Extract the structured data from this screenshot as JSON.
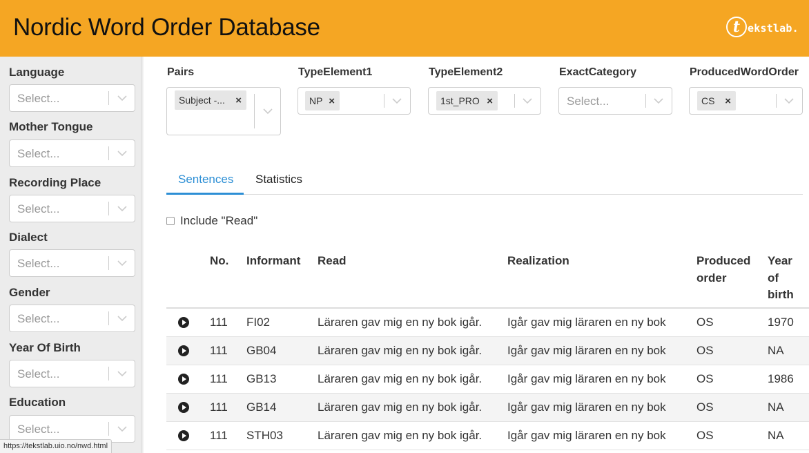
{
  "header": {
    "title": "Nordic Word Order Database",
    "logo_letter": "t",
    "logo_text": "ekstlab."
  },
  "sidebar": {
    "filters": [
      {
        "label": "Language",
        "placeholder": "Select..."
      },
      {
        "label": "Mother Tongue",
        "placeholder": "Select..."
      },
      {
        "label": "Recording Place",
        "placeholder": "Select..."
      },
      {
        "label": "Dialect",
        "placeholder": "Select..."
      },
      {
        "label": "Gender",
        "placeholder": "Select..."
      },
      {
        "label": "Year Of Birth",
        "placeholder": "Select..."
      },
      {
        "label": "Education",
        "placeholder": "Select..."
      }
    ]
  },
  "filters": {
    "pairs": {
      "label": "Pairs",
      "chip": "Subject -..."
    },
    "type1": {
      "label": "TypeElement1",
      "chip": "NP"
    },
    "type2": {
      "label": "TypeElement2",
      "chip": "1st_PRO"
    },
    "exact": {
      "label": "ExactCategory",
      "placeholder": "Select..."
    },
    "produced": {
      "label": "ProducedWordOrder",
      "chip": "CS"
    },
    "remove_symbol": "×"
  },
  "tabs": [
    {
      "label": "Sentences",
      "active": true
    },
    {
      "label": "Statistics",
      "active": false
    }
  ],
  "include_read": {
    "label": "Include \"Read\"",
    "checked": false
  },
  "table": {
    "headers": {
      "no": "No.",
      "informant": "Informant",
      "read": "Read",
      "realization": "Realization",
      "produced_1": "Produced",
      "produced_2": "order",
      "yob_1": "Year",
      "yob_2": "of",
      "yob_3": "birth"
    },
    "rows": [
      {
        "no": "111",
        "informant": "FI02",
        "read": "Läraren gav mig en ny bok igår.",
        "realization": "Igår gav mig läraren en ny bok",
        "produced": "OS",
        "yob": "1970"
      },
      {
        "no": "111",
        "informant": "GB04",
        "read": "Läraren gav mig en ny bok igår.",
        "realization": "Igår gav mig läraren en ny bok",
        "produced": "OS",
        "yob": "NA"
      },
      {
        "no": "111",
        "informant": "GB13",
        "read": "Läraren gav mig en ny bok igår.",
        "realization": "Igår gav mig läraren en ny bok",
        "produced": "OS",
        "yob": "1986"
      },
      {
        "no": "111",
        "informant": "GB14",
        "read": "Läraren gav mig en ny bok igår.",
        "realization": "Igår gav mig läraren en ny bok",
        "produced": "OS",
        "yob": "NA"
      },
      {
        "no": "111",
        "informant": "STH03",
        "read": "Läraren gav mig en ny bok igår.",
        "realization": "Igår gav mig läraren en ny bok",
        "produced": "OS",
        "yob": "NA"
      }
    ]
  },
  "status_url": "https://tekstlab.uio.no/nwd.html",
  "colors": {
    "header": "#f5a623",
    "accent": "#2d8fd5"
  }
}
